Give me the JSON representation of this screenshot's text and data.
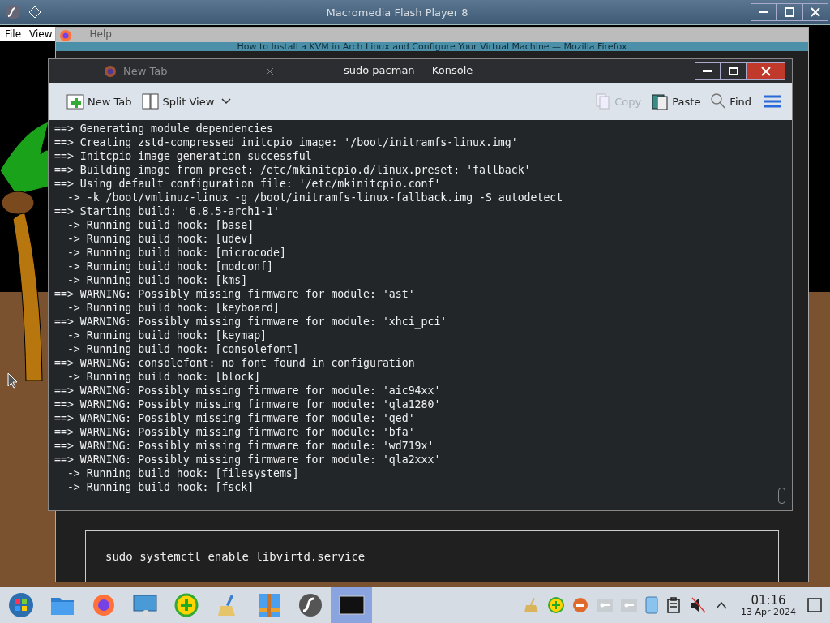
{
  "flash_window": {
    "title": "Macromedia Flash Player 8",
    "menu": [
      {
        "label": "File"
      },
      {
        "label": "View"
      },
      {
        "label": "Help"
      }
    ]
  },
  "browser_window": {
    "title": "How to Install a KVM in Arch Linux and Configure Your Virtual Machine — Mozilla Firefox",
    "tab": {
      "label": "New Tab"
    },
    "code_block": "sudo systemctl enable libvirtd.service"
  },
  "konsole": {
    "title": "sudo pacman — Konsole",
    "toolbar": [
      {
        "kind": "newtab",
        "label": "New Tab",
        "disabled": false
      },
      {
        "kind": "split",
        "label": "Split View",
        "disabled": false
      },
      {
        "kind": "copy",
        "label": "Copy",
        "disabled": true
      },
      {
        "kind": "paste",
        "label": "Paste",
        "disabled": false
      },
      {
        "kind": "find",
        "label": "Find",
        "disabled": false
      }
    ],
    "lines": [
      "==> Generating module dependencies",
      "==> Creating zstd-compressed initcpio image: '/boot/initramfs-linux.img'",
      "==> Initcpio image generation successful",
      "==> Building image from preset: /etc/mkinitcpio.d/linux.preset: 'fallback'",
      "==> Using default configuration file: '/etc/mkinitcpio.conf'",
      "  -> -k /boot/vmlinuz-linux -g /boot/initramfs-linux-fallback.img -S autodetect",
      "==> Starting build: '6.8.5-arch1-1'",
      "  -> Running build hook: [base]",
      "  -> Running build hook: [udev]",
      "  -> Running build hook: [microcode]",
      "  -> Running build hook: [modconf]",
      "  -> Running build hook: [kms]",
      "==> WARNING: Possibly missing firmware for module: 'ast'",
      "  -> Running build hook: [keyboard]",
      "==> WARNING: Possibly missing firmware for module: 'xhci_pci'",
      "  -> Running build hook: [keymap]",
      "  -> Running build hook: [consolefont]",
      "==> WARNING: consolefont: no font found in configuration",
      "  -> Running build hook: [block]",
      "==> WARNING: Possibly missing firmware for module: 'aic94xx'",
      "==> WARNING: Possibly missing firmware for module: 'qla1280'",
      "==> WARNING: Possibly missing firmware for module: 'qed'",
      "==> WARNING: Possibly missing firmware for module: 'bfa'",
      "==> WARNING: Possibly missing firmware for module: 'wd719x'",
      "==> WARNING: Possibly missing firmware for module: 'qla2xxx'",
      "  -> Running build hook: [filesystems]",
      "  -> Running build hook: [fsck]"
    ]
  },
  "taskbar": {
    "apps": [
      {
        "kind": "start",
        "selected": false
      },
      {
        "kind": "files",
        "selected": false
      },
      {
        "kind": "firefox",
        "selected": false
      },
      {
        "kind": "remote",
        "selected": false
      },
      {
        "kind": "plus",
        "selected": false
      },
      {
        "kind": "cleaner",
        "selected": false
      },
      {
        "kind": "archive",
        "selected": false
      },
      {
        "kind": "flash",
        "selected": false
      },
      {
        "kind": "terminal",
        "selected": true
      }
    ],
    "tray": [
      {
        "kind": "cleaner"
      },
      {
        "kind": "plus"
      },
      {
        "kind": "stop"
      },
      {
        "kind": "key"
      },
      {
        "kind": "key"
      },
      {
        "kind": "phone"
      },
      {
        "kind": "clipboard"
      },
      {
        "kind": "volume",
        "muted": true
      },
      {
        "kind": "expand"
      }
    ],
    "clock": {
      "time": "01:16",
      "date": "13 Apr 2024"
    }
  }
}
